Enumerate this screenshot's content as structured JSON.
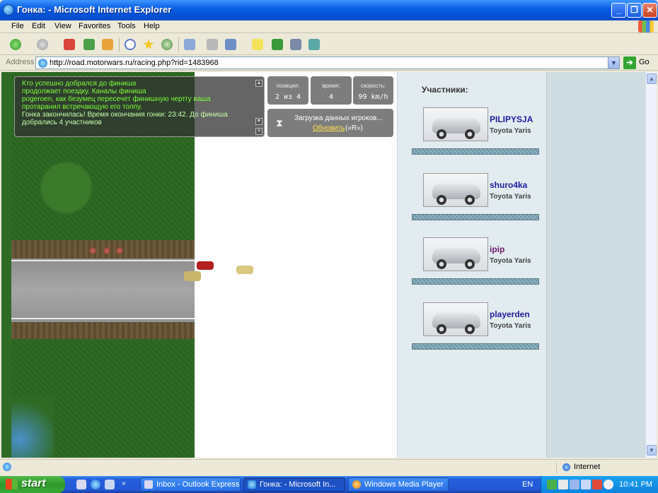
{
  "window": {
    "title": "Гонка: - Microsoft Internet Explorer"
  },
  "menu": {
    "items": [
      "File",
      "Edit",
      "View",
      "Favorites",
      "Tools",
      "Help"
    ]
  },
  "address": {
    "label": "Address",
    "url": "http://road.motorwars.ru/racing.php?rid=1483968",
    "go_label": "Go"
  },
  "console": {
    "lines": [
      "Кто успешно добрался до финиша",
      "продолжает поездку. Каналы финиша",
      "pogeroen, как безумец пересечет финишную чертгу ваша",
      "протаранил встречающую его толпу.",
      "Гонка закончилась! Время окончания гонки: 23:42. До финиша",
      "добрались 4 участников"
    ],
    "line_colors": [
      "#7cff3a",
      "#7cff3a",
      "#7cff3a",
      "#7cff3a",
      "#c8ffae",
      "#c8ffae"
    ]
  },
  "stats": [
    {
      "label": "позиция:",
      "value": "2 из 4"
    },
    {
      "label": "время:",
      "value": "4"
    },
    {
      "label": "скорость:",
      "value": "99 km/h"
    }
  ],
  "loading": {
    "message": "Загрузка данных игроков...",
    "refresh_label": "Обновить",
    "hotkey": "(«R»)"
  },
  "participants": {
    "heading": "Участники:",
    "items": [
      {
        "name": "PILIPYSJA",
        "model": "Toyota Yaris",
        "name_color": "#1d1d9e"
      },
      {
        "name": "shuro4ka",
        "model": "Toyota Yaris",
        "name_color": "#1d1d9e"
      },
      {
        "name": "ipip",
        "model": "Toyota Yaris",
        "name_color": "#6a1a6a"
      },
      {
        "name": "playerden",
        "model": "Toyota Yaris",
        "name_color": "#1d1d9e"
      }
    ]
  },
  "statusbar": {
    "zone": "Internet"
  },
  "taskbar": {
    "start_label": "start",
    "tasks": [
      {
        "label": "Inbox - Outlook Express",
        "active": false
      },
      {
        "label": "Гонка: - Microsoft In...",
        "active": true
      },
      {
        "label": "Windows Media Player",
        "active": false
      }
    ],
    "language": "EN",
    "clock": "10:41 PM"
  }
}
